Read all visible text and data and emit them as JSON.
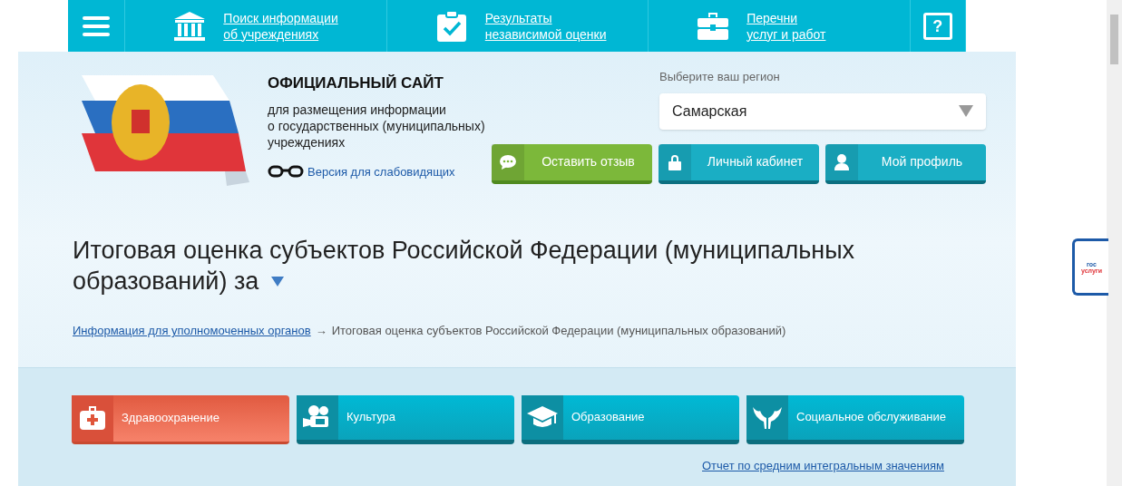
{
  "top_nav": {
    "items": [
      {
        "kind": "menu"
      },
      {
        "kind": "link",
        "line_1": "Поиск информации",
        "line_2": "об учреждениях"
      },
      {
        "kind": "link",
        "line_1": "Результаты",
        "line_2": "независимой оценки"
      },
      {
        "kind": "link",
        "line_1": "Перечни",
        "line_2": "услуг и работ"
      },
      {
        "kind": "help",
        "label": "?"
      }
    ]
  },
  "header": {
    "site_title": "ОФИЦИАЛЬНЫЙ САЙТ",
    "site_subtitle": [
      "для размещения информации",
      "о государственных (муниципальных)",
      "учреждениях"
    ],
    "accessibility_link": "Версия для слабовидящих",
    "region_label": "Выберите ваш регион",
    "region_value": "Самарская",
    "buttons": [
      {
        "label": "Оставить отзыв",
        "kind": "feedback"
      },
      {
        "label": "Личный кабинет",
        "kind": "account"
      },
      {
        "label": "Мой профиль",
        "kind": "account"
      }
    ]
  },
  "page_title_lines": [
    "Итоговая оценка субъектов Российской Федерации (муниципальных",
    "образований) за"
  ],
  "breadcrumb": {
    "link": "Информация для уполномоченных органов",
    "separator": "→",
    "current": "Итоговая оценка субъектов Российской Федерации (муниципальных образований)"
  },
  "categories": [
    {
      "label": "Здравоохранение",
      "selected": true
    },
    {
      "label": "Культура",
      "selected": false
    },
    {
      "label": "Образование",
      "selected": false
    },
    {
      "label": "Социальное обслуживание",
      "selected": false
    }
  ],
  "report_link": "Отчет по средним интегральным значениям",
  "side_widget": {
    "line_1": "гос",
    "line_2": "услуги"
  }
}
